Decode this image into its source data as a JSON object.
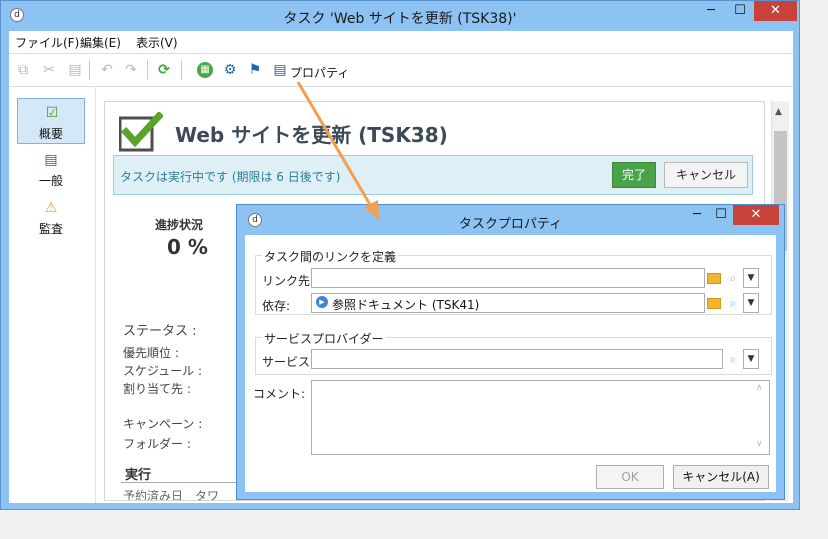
{
  "main_window": {
    "title": "タスク 'Web サイトを更新 (TSK38)'",
    "controls": {
      "minimize": "─",
      "maximize": "☐",
      "close": "✕"
    }
  },
  "menu": [
    "ファイル(F)",
    "編集(E)",
    "表示(V)"
  ],
  "toolbar": {
    "properties_label": "プロパティ"
  },
  "nav": [
    {
      "label": "概要",
      "icon": "☑"
    },
    {
      "label": "一般",
      "icon": "📋"
    },
    {
      "label": "監査",
      "icon": "⚠"
    }
  ],
  "task": {
    "title": "Web サイトを更新 (TSK38)",
    "status_message": "タスクは実行中です (期限は 6 日後です)",
    "done_button": "完了",
    "cancel_button": "キャンセル",
    "progress_label": "進捗状況",
    "progress_value": "0 %",
    "fields": {
      "status": "ステータス :",
      "priority": "優先順位 :",
      "schedule": "スケジュール :",
      "assigned": "割り当て先 :",
      "campaign": "キャンペーン :",
      "folder": "フォルダー :"
    },
    "execution_heading": "実行",
    "execution_partial": "予約済み日　タワ"
  },
  "dialog": {
    "title": "タスクプロパティ",
    "controls": {
      "minimize": "─",
      "maximize": "☐",
      "close": "✕"
    },
    "links_group": "タスク間のリンクを定義",
    "link_to_label": "リンク先:",
    "link_to_value": "",
    "depends_label": "依存:",
    "depends_value": "参照ドキュメント (TSK41)",
    "provider_group": "サービスプロバイダー",
    "service_label": "サービス:",
    "service_value": "",
    "comment_label": "コメント:",
    "comment_value": "",
    "ok_button": "OK",
    "cancel_button": "キャンセル(A)"
  },
  "colors": {
    "title_bar": "#8cc3f2",
    "close_button": "#c7433a",
    "done_button": "#49a349",
    "status_bg": "#def0f6",
    "status_text": "#2b7c95",
    "arrow": "#f0a050",
    "check_green": "#5aa22c"
  }
}
